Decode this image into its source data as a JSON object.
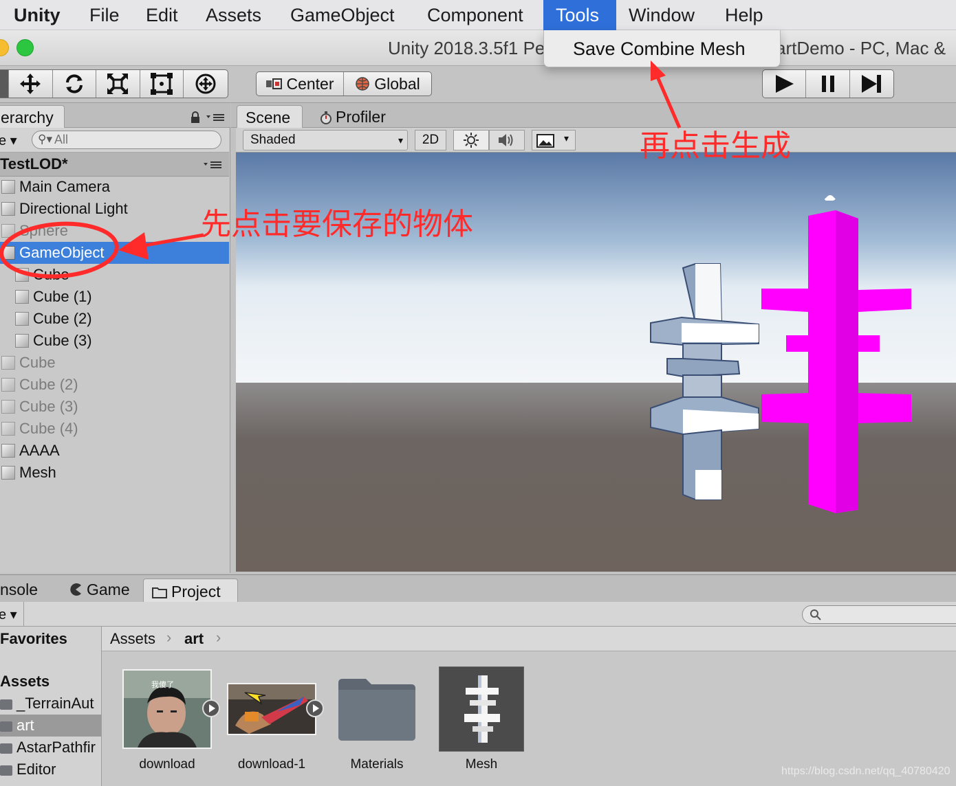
{
  "menubar": {
    "app": "Unity",
    "items": [
      "File",
      "Edit",
      "Assets",
      "GameObject",
      "Component",
      "Tools",
      "Window",
      "Help"
    ]
  },
  "titlebar": {
    "title": "Unity 2018.3.5f1 Pe",
    "title_suffix": "artDemo - PC, Mac &"
  },
  "tools_menu": {
    "items": [
      "Save Combine Mesh"
    ]
  },
  "toolbar": {
    "pivot_label": "Center",
    "space_label": "Global"
  },
  "hierarchy": {
    "tab_label": "erarchy",
    "create_label": "e",
    "search_placeholder": "All",
    "scene_name": "TestLOD*",
    "items": [
      {
        "label": "Main Camera"
      },
      {
        "label": "Directional Light"
      },
      {
        "label": "Sphere"
      },
      {
        "label": "GameObject"
      },
      {
        "label": "Cube"
      },
      {
        "label": "Cube (1)"
      },
      {
        "label": "Cube (2)"
      },
      {
        "label": "Cube (3)"
      },
      {
        "label": "Cube"
      },
      {
        "label": "Cube (2)"
      },
      {
        "label": "Cube (3)"
      },
      {
        "label": "Cube (4)"
      },
      {
        "label": "AAAA"
      },
      {
        "label": "Mesh"
      }
    ]
  },
  "scene": {
    "tab_scene": "Scene",
    "tab_profiler": "Profiler",
    "shading_mode": "Shaded",
    "mode_2d": "2D"
  },
  "annotations": {
    "step1": "先点击要保存的物体",
    "step2": "再点击生成"
  },
  "bottom": {
    "tab_console": "nsole",
    "tab_game": "Game",
    "tab_project": "Project",
    "create_label": "e"
  },
  "project": {
    "favorites": "Favorites",
    "assets_root": "Assets",
    "folders": [
      "_TerrainAut",
      "art",
      "AstarPathfir",
      "Editor"
    ],
    "breadcrumb": [
      "Assets",
      "art"
    ],
    "assets": [
      {
        "label": "download",
        "thumb_text": "我傻了"
      },
      {
        "label": "download-1"
      },
      {
        "label": "Materials"
      },
      {
        "label": "Mesh"
      }
    ]
  },
  "watermark": "https://blog.csdn.net/qq_40780420",
  "colors": {
    "menu_active": "#2f6fd9",
    "selection": "#3d80dc",
    "annotation": "#ff2b2b",
    "magenta_mesh": "#ff00ff"
  }
}
